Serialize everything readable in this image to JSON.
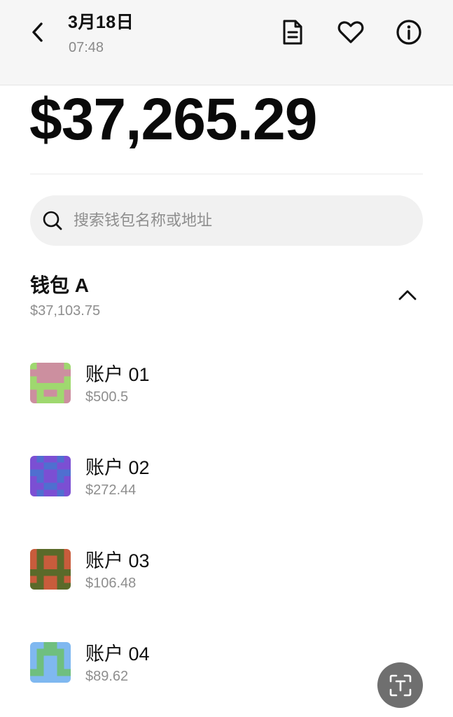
{
  "header": {
    "title": "3月18日",
    "time": "07:48",
    "icons": [
      "back-arrow-icon",
      "document-icon",
      "heart-icon",
      "info-icon"
    ]
  },
  "balance": "$37,265.29",
  "search": {
    "placeholder": "搜索钱包名称或地址",
    "value": ""
  },
  "wallet": {
    "name": "钱包 A",
    "total": "$37,103.75",
    "expanded": true
  },
  "accounts": [
    {
      "name": "账户 01",
      "balance": "$500.5",
      "colors": [
        "#cc8f9f",
        "#9fd86f"
      ]
    },
    {
      "name": "账户 02",
      "balance": "$272.44",
      "colors": [
        "#7b4fd3",
        "#4f6fd0"
      ]
    },
    {
      "name": "账户 03",
      "balance": "$106.48",
      "colors": [
        "#c85c3c",
        "#5a6a2a"
      ]
    },
    {
      "name": "账户 04",
      "balance": "$89.62",
      "colors": [
        "#7fb8f0",
        "#6fbf7f"
      ]
    }
  ],
  "fab": {
    "icon": "scan-text-icon"
  },
  "colors": {
    "header_bg": "#f6f6f6",
    "muted": "#8e8e8e",
    "fab_bg": "#6f6f6f"
  }
}
